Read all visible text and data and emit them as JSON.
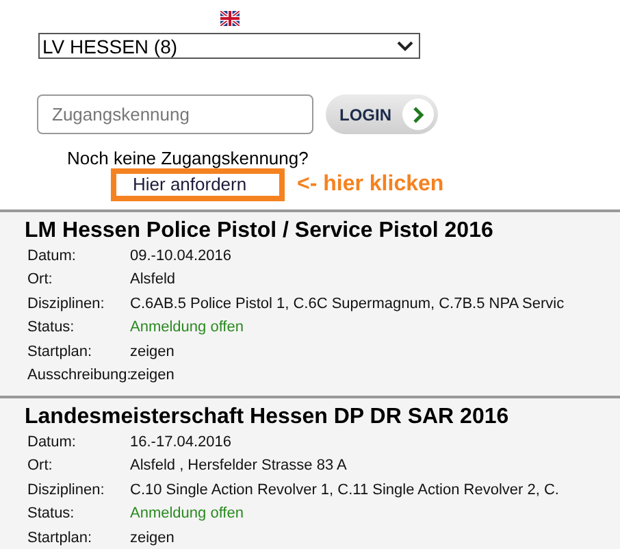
{
  "region_select": {
    "value": "LV HESSEN (8)"
  },
  "login": {
    "placeholder": "Zugangskennung",
    "button": "LOGIN"
  },
  "no_account": {
    "question": "Noch keine Zugangskennung?",
    "link": "Hier anfordern",
    "hint": "<- hier klicken"
  },
  "events": [
    {
      "title": "LM Hessen Police Pistol / Service Pistol 2016",
      "rows": [
        {
          "label": "Datum:",
          "value": "09.-10.04.2016",
          "kind": "text"
        },
        {
          "label": "Ort:",
          "value": "Alsfeld",
          "kind": "text"
        },
        {
          "label": "Disziplinen:",
          "value": "C.6AB.5 Police Pistol 1, C.6C Supermagnum, C.7B.5 NPA Servic",
          "kind": "text"
        },
        {
          "label": "Status:",
          "value": "Anmeldung offen",
          "kind": "status"
        },
        {
          "label": "Startplan:",
          "value": "zeigen",
          "kind": "link"
        },
        {
          "label": "Ausschreibung:",
          "value": "zeigen",
          "kind": "link"
        }
      ]
    },
    {
      "title": "Landesmeisterschaft Hessen DP DR SAR 2016",
      "rows": [
        {
          "label": "Datum:",
          "value": "16.-17.04.2016",
          "kind": "text"
        },
        {
          "label": "Ort:",
          "value": "Alsfeld , Hersfelder Strasse 83 A",
          "kind": "text"
        },
        {
          "label": "Disziplinen:",
          "value": "C.10 Single Action Revolver 1, C.11 Single Action Revolver 2, C.",
          "kind": "text"
        },
        {
          "label": "Status:",
          "value": "Anmeldung offen",
          "kind": "status"
        },
        {
          "label": "Startplan:",
          "value": "zeigen",
          "kind": "link"
        }
      ]
    }
  ]
}
